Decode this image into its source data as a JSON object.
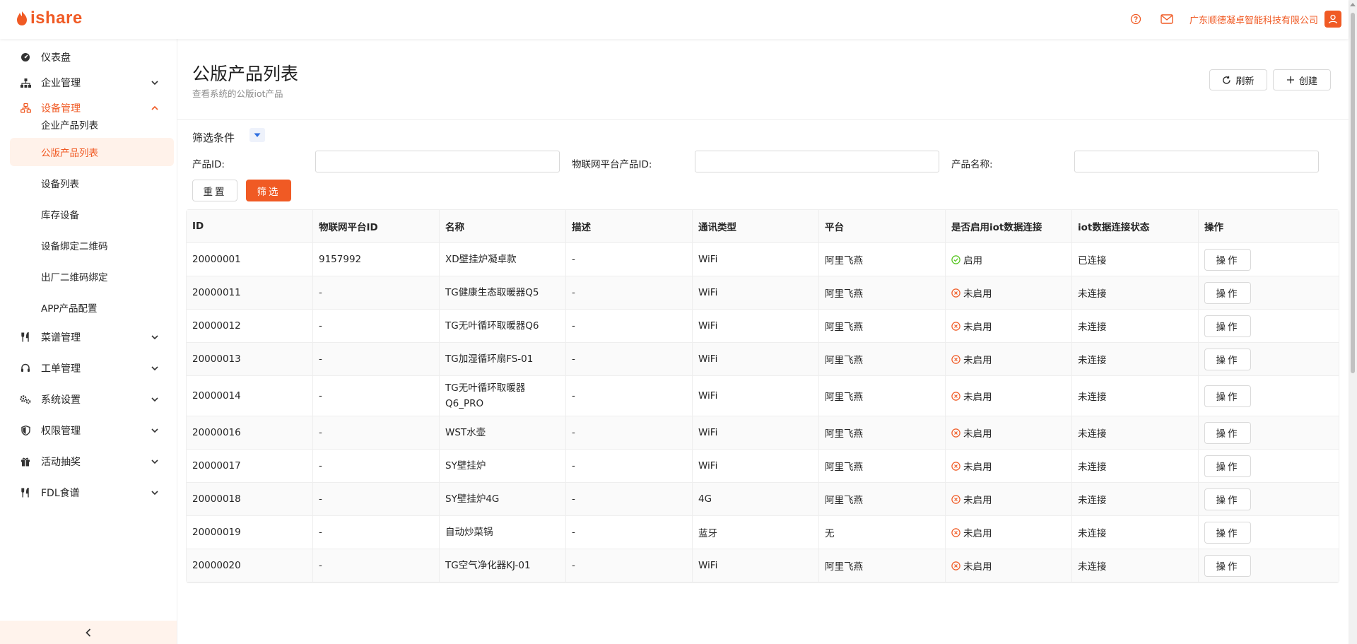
{
  "header": {
    "logo_text": "ishare",
    "company": "广东顺德凝卓智能科技有限公司",
    "accent_color": "#f05a24"
  },
  "sidebar": {
    "items": [
      {
        "label": "仪表盘",
        "icon": "dashboard-icon"
      },
      {
        "label": "企业管理",
        "icon": "org-tree-icon"
      },
      {
        "label": "设备管理",
        "icon": "device-tree-icon"
      },
      {
        "label": "菜谱管理",
        "icon": "fork-knife-icon"
      },
      {
        "label": "工单管理",
        "icon": "headset-icon"
      },
      {
        "label": "系统设置",
        "icon": "gears-icon"
      },
      {
        "label": "权限管理",
        "icon": "shield-icon"
      },
      {
        "label": "活动抽奖",
        "icon": "gift-icon"
      },
      {
        "label": "FDL食谱",
        "icon": "fork-knife-icon"
      }
    ],
    "sub_items": [
      {
        "label": "企业产品列表"
      },
      {
        "label": "公版产品列表"
      },
      {
        "label": "设备列表"
      },
      {
        "label": "库存设备"
      },
      {
        "label": "设备绑定二维码"
      },
      {
        "label": "出厂二维码绑定"
      },
      {
        "label": "APP产品配置"
      }
    ]
  },
  "page": {
    "title": "公版产品列表",
    "subtitle": "查看系统的公版iot产品",
    "refresh_label": "刷新",
    "create_label": "创建"
  },
  "filter": {
    "title": "筛选条件",
    "fields": [
      {
        "label": "产品ID:",
        "value": ""
      },
      {
        "label": "物联网平台产品ID:",
        "value": ""
      },
      {
        "label": "产品名称:",
        "value": ""
      }
    ],
    "reset_label": "重置",
    "filter_label": "筛选"
  },
  "table": {
    "columns": [
      "ID",
      "物联网平台ID",
      "名称",
      "描述",
      "通讯类型",
      "平台",
      "是否启用iot数据连接",
      "iot数据连接状态",
      "操作"
    ],
    "rows": [
      {
        "id": "20000001",
        "platform_id": "9157992",
        "name": "XD壁挂炉凝卓款",
        "desc": "-",
        "comm": "WiFi",
        "platform": "阿里飞燕",
        "enabled": "启用",
        "enabled_on": true,
        "conn": "已连接",
        "op": "操作"
      },
      {
        "id": "20000011",
        "platform_id": "-",
        "name": "TG健康生态取暖器Q5",
        "desc": "-",
        "comm": "WiFi",
        "platform": "阿里飞燕",
        "enabled": "未启用",
        "enabled_on": false,
        "conn": "未连接",
        "op": "操作"
      },
      {
        "id": "20000012",
        "platform_id": "-",
        "name": "TG无叶循环取暖器Q6",
        "desc": "-",
        "comm": "WiFi",
        "platform": "阿里飞燕",
        "enabled": "未启用",
        "enabled_on": false,
        "conn": "未连接",
        "op": "操作"
      },
      {
        "id": "20000013",
        "platform_id": "-",
        "name": "TG加湿循环扇FS-01",
        "desc": "-",
        "comm": "WiFi",
        "platform": "阿里飞燕",
        "enabled": "未启用",
        "enabled_on": false,
        "conn": "未连接",
        "op": "操作"
      },
      {
        "id": "20000014",
        "platform_id": "-",
        "name": "TG无叶循环取暖器Q6_PRO",
        "desc": "-",
        "comm": "WiFi",
        "platform": "阿里飞燕",
        "enabled": "未启用",
        "enabled_on": false,
        "conn": "未连接",
        "op": "操作"
      },
      {
        "id": "20000016",
        "platform_id": "-",
        "name": "WST水壶",
        "desc": "-",
        "comm": "WiFi",
        "platform": "阿里飞燕",
        "enabled": "未启用",
        "enabled_on": false,
        "conn": "未连接",
        "op": "操作"
      },
      {
        "id": "20000017",
        "platform_id": "-",
        "name": "SY壁挂炉",
        "desc": "-",
        "comm": "WiFi",
        "platform": "阿里飞燕",
        "enabled": "未启用",
        "enabled_on": false,
        "conn": "未连接",
        "op": "操作"
      },
      {
        "id": "20000018",
        "platform_id": "-",
        "name": "SY壁挂炉4G",
        "desc": "-",
        "comm": "4G",
        "platform": "阿里飞燕",
        "enabled": "未启用",
        "enabled_on": false,
        "conn": "未连接",
        "op": "操作"
      },
      {
        "id": "20000019",
        "platform_id": "-",
        "name": "自动炒菜锅",
        "desc": "-",
        "comm": "蓝牙",
        "platform": "无",
        "enabled": "未启用",
        "enabled_on": false,
        "conn": "未连接",
        "op": "操作"
      },
      {
        "id": "20000020",
        "platform_id": "-",
        "name": "TG空气净化器KJ-01",
        "desc": "-",
        "comm": "WiFi",
        "platform": "阿里飞燕",
        "enabled": "未启用",
        "enabled_on": false,
        "conn": "未连接",
        "op": "操作"
      }
    ]
  }
}
